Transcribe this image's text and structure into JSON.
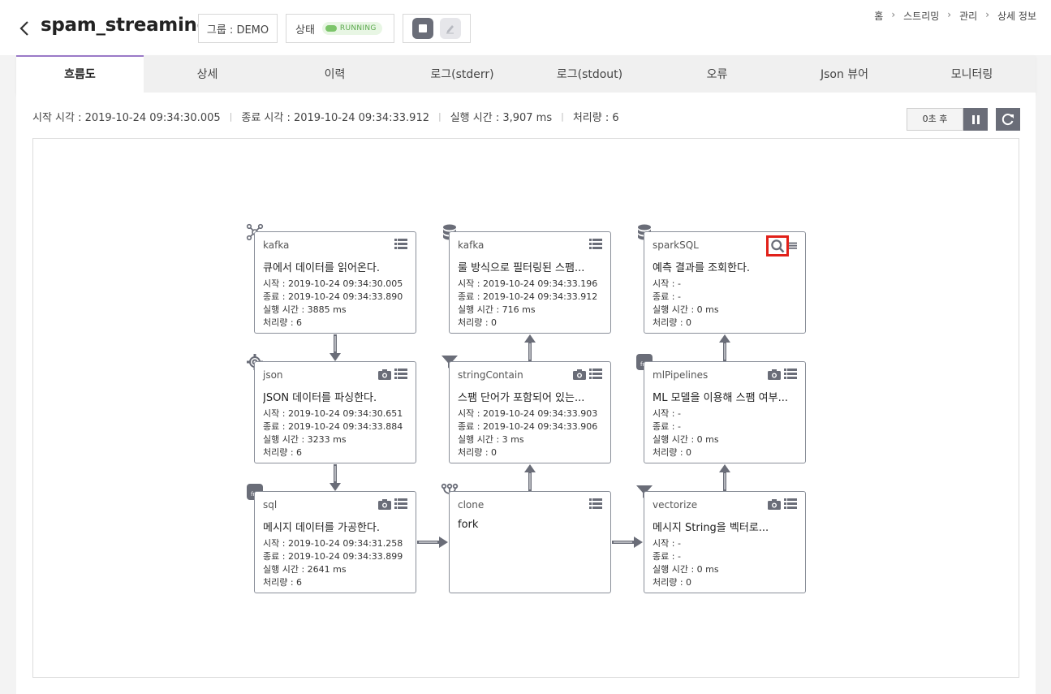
{
  "header": {
    "title": "spam_streaming",
    "group_label": "그룹 : DEMO",
    "status_label": "상태",
    "status_value": "RUNNING",
    "breadcrumb": [
      "홈",
      "스트리밍",
      "관리",
      "상세 정보"
    ]
  },
  "tabs": [
    "흐름도",
    "상세",
    "이력",
    "로그(stderr)",
    "로그(stdout)",
    "오류",
    "Json 뷰어",
    "모니터링"
  ],
  "stats": {
    "start": "시작 시각 : 2019-10-24 09:34:30.005",
    "end": "종료 시각 : 2019-10-24 09:34:33.912",
    "elapsed": "실행 시간 : 3,907 ms",
    "throughput": "처리량 : 6"
  },
  "refresh": {
    "timer_label": "0초 후"
  },
  "nodes": {
    "n1": {
      "type": "kafka",
      "desc": "큐에서 데이터를 읽어온다.",
      "start": "시작 : 2019-10-24 09:34:30.005",
      "end": "종료 : 2019-10-24 09:34:33.890",
      "elapsed": "실행 시간 : 3885 ms",
      "count": "처리량 : 6"
    },
    "n2": {
      "type": "json",
      "desc": "JSON 데이터를 파싱한다.",
      "start": "시작 : 2019-10-24 09:34:30.651",
      "end": "종료 : 2019-10-24 09:34:33.884",
      "elapsed": "실행 시간 : 3233 ms",
      "count": "처리량 : 6"
    },
    "n3": {
      "type": "sql",
      "desc": "메시지 데이터를 가공한다.",
      "start": "시작 : 2019-10-24 09:34:31.258",
      "end": "종료 : 2019-10-24 09:34:33.899",
      "elapsed": "실행 시간 : 2641 ms",
      "count": "처리량 : 6"
    },
    "n4": {
      "type": "kafka",
      "desc": "룰 방식으로 필터링된 스팸...",
      "start": "시작 : 2019-10-24 09:34:33.196",
      "end": "종료 : 2019-10-24 09:34:33.912",
      "elapsed": "실행 시간 : 716 ms",
      "count": "처리량 : 0"
    },
    "n5": {
      "type": "stringContain",
      "desc": "스팸 단어가 포함되어 있는...",
      "start": "시작 : 2019-10-24 09:34:33.903",
      "end": "종료 : 2019-10-24 09:34:33.906",
      "elapsed": "실행 시간 : 3 ms",
      "count": "처리량 : 0"
    },
    "n6": {
      "type": "clone",
      "desc": "fork"
    },
    "n7": {
      "type": "sparkSQL",
      "desc": "예측 결과를 조회한다.",
      "start": "시작 : -",
      "end": "종료 : -",
      "elapsed": "실행 시간 : 0 ms",
      "count": "처리량 : 0"
    },
    "n8": {
      "type": "mlPipelines",
      "desc": "ML 모델을 이용해 스팸 여부...",
      "start": "시작 : -",
      "end": "종료 : -",
      "elapsed": "실행 시간 : 0 ms",
      "count": "처리량 : 0"
    },
    "n9": {
      "type": "vectorize",
      "desc": "메시지 String을 벡터로...",
      "start": "시작 : -",
      "end": "종료 : -",
      "elapsed": "실행 시간 : 0 ms",
      "count": "처리량 : 0"
    }
  },
  "colors": {
    "accent": "#9a79c7",
    "button": "#6a6d78",
    "status_green": "#7cc56a",
    "highlight": "#e1211a"
  }
}
